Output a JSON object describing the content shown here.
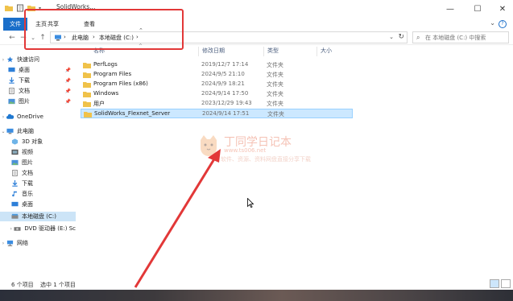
{
  "window": {
    "title": "SolidWorks...",
    "min": "—",
    "max": "☐",
    "close": "✕"
  },
  "ribbon": {
    "tabs": [
      "文件",
      "主页",
      "共享",
      "查看"
    ],
    "collapse": "⌃",
    "help": "?"
  },
  "nav": {
    "back": "←",
    "forward": "→",
    "dropdown": "⌄",
    "up": "↑"
  },
  "address": {
    "crumbs": [
      "此电脑",
      "本地磁盘 (C:)"
    ],
    "sep": "›",
    "refresh": "↻",
    "dropdown": "⌄"
  },
  "search": {
    "placeholder": "在 本地磁盘 (C:) 中搜索"
  },
  "sidebar": {
    "items": [
      {
        "label": "快速访问",
        "icon": "star-icon",
        "pinned": false
      },
      {
        "label": "桌面",
        "icon": "desktop-icon",
        "pinned": true
      },
      {
        "label": "下载",
        "icon": "download-icon",
        "pinned": true
      },
      {
        "label": "文档",
        "icon": "document-icon",
        "pinned": true
      },
      {
        "label": "图片",
        "icon": "picture-icon",
        "pinned": true
      },
      {
        "label": "OneDrive",
        "icon": "cloud-icon",
        "pinned": false
      },
      {
        "label": "此电脑",
        "icon": "computer-icon",
        "pinned": false
      },
      {
        "label": "3D 对象",
        "icon": "cube-icon",
        "pinned": false
      },
      {
        "label": "视频",
        "icon": "video-icon",
        "pinned": false
      },
      {
        "label": "图片",
        "icon": "picture-icon",
        "pinned": false
      },
      {
        "label": "文档",
        "icon": "document-icon",
        "pinned": false
      },
      {
        "label": "下载",
        "icon": "download-icon",
        "pinned": false
      },
      {
        "label": "音乐",
        "icon": "music-icon",
        "pinned": false
      },
      {
        "label": "桌面",
        "icon": "desktop-icon",
        "pinned": false
      },
      {
        "label": "本地磁盘 (C:)",
        "icon": "drive-icon",
        "pinned": false,
        "selected": true
      },
      {
        "label": "DVD 驱动器 (E:) Sc",
        "icon": "dvd-icon",
        "pinned": false
      },
      {
        "label": "网络",
        "icon": "network-icon",
        "pinned": false
      }
    ]
  },
  "columns": {
    "name": "名称",
    "date": "修改日期",
    "type": "类型",
    "size": "大小"
  },
  "files": [
    {
      "name": "PerfLogs",
      "date": "2019/12/7 17:14",
      "type": "文件夹"
    },
    {
      "name": "Program Files",
      "date": "2024/9/5 21:10",
      "type": "文件夹"
    },
    {
      "name": "Program Files (x86)",
      "date": "2024/9/9 18:21",
      "type": "文件夹"
    },
    {
      "name": "Windows",
      "date": "2024/9/14 17:50",
      "type": "文件夹"
    },
    {
      "name": "用户",
      "date": "2023/12/29 19:43",
      "type": "文件夹"
    },
    {
      "name": "SolidWorks_Flexnet_Server",
      "date": "2024/9/14 17:51",
      "type": "文件夹",
      "selected": true
    }
  ],
  "status": {
    "count": "6 个项目",
    "selected": "选中 1 个项目"
  },
  "watermark": {
    "title": "丁同学日记本",
    "url": "www.ts006.net",
    "tagline": "软件、资源、资料网盘直接分享下载"
  },
  "colors": {
    "accent": "#1a6ec9",
    "selection": "#cce8ff",
    "annotation": "#e23838",
    "folder": "#f0c24a"
  }
}
